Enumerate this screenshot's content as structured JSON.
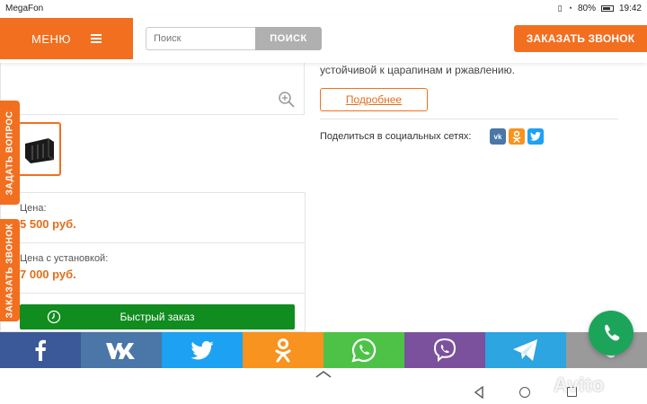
{
  "status_bar": {
    "carrier": "MegaFon",
    "battery": "80%",
    "time": "19:42"
  },
  "header": {
    "menu_label": "МЕНЮ",
    "search_placeholder": "Поиск",
    "search_button": "ПОИСК",
    "call_button": "ЗАКАЗАТЬ ЗВОНОК"
  },
  "side_tabs": {
    "ask_question": "ЗАДАТЬ ВОПРОС",
    "order_call": "ЗАКАЗАТЬ ЗВОНОК"
  },
  "product": {
    "description_tail": "устойчивой к царапинам и ржавлению.",
    "more_button": "Подробнее",
    "share_label": "Поделиться в социальных сетях:",
    "share_networks": [
      "vk-icon",
      "odnoklassniki-icon",
      "twitter-icon"
    ],
    "price_label": "Цена:",
    "price_value": "5 500 руб.",
    "install_label": "Цена с установкой:",
    "install_value": "7 000 руб.",
    "quick_order": "Быстрый заказ"
  },
  "social_bar": [
    {
      "icon": "facebook-icon",
      "color": "#3b5998"
    },
    {
      "icon": "vk-icon",
      "color": "#4a76a8"
    },
    {
      "icon": "twitter-icon",
      "color": "#1da1f2"
    },
    {
      "icon": "odnoklassniki-icon",
      "color": "#f7931e"
    },
    {
      "icon": "whatsapp-icon",
      "color": "#4dc247"
    },
    {
      "icon": "viber-icon",
      "color": "#7b519d"
    },
    {
      "icon": "telegram-icon",
      "color": "#2ca5e0"
    },
    {
      "icon": "phone-icon",
      "color": "#9a9a9a"
    }
  ],
  "colors": {
    "accent": "#f26f1f",
    "price": "#e0701c",
    "quick_order": "#118c1f",
    "phone_fab": "#1ca55a"
  },
  "watermark": "Avito"
}
